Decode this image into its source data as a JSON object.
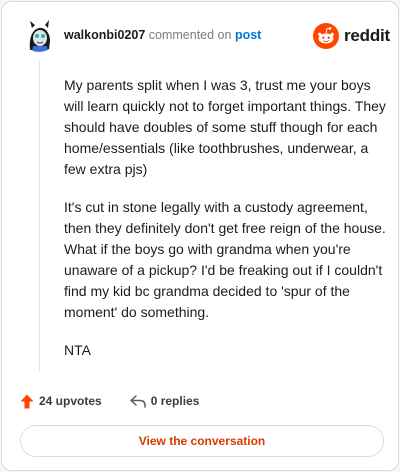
{
  "comment": {
    "username": "walkonbi0207",
    "action": "commented on",
    "target": "post",
    "paragraphs": [
      "My parents split when I was 3, trust me your boys will learn quickly not to forget important things. They should have doubles of some stuff though for each home/essentials (like toothbrushes, underwear, a few extra pjs)",
      "It's cut in stone legally with a custody agreement, then they definitely don't get free reign of the house. What if the boys go with grandma when you're unaware of a pickup? I'd be freaking out if I couldn't find my kid bc grandma decided to 'spur of the moment' do something.",
      "NTA"
    ]
  },
  "brand": {
    "name": "reddit",
    "color": "#ff4500"
  },
  "footer": {
    "upvotes": "24 upvotes",
    "replies": "0 replies",
    "upvote_icon": "upvote-arrow-icon",
    "reply_icon": "reply-arrow-icon"
  },
  "cta": {
    "label": "View the conversation",
    "color": "#d93a00"
  }
}
